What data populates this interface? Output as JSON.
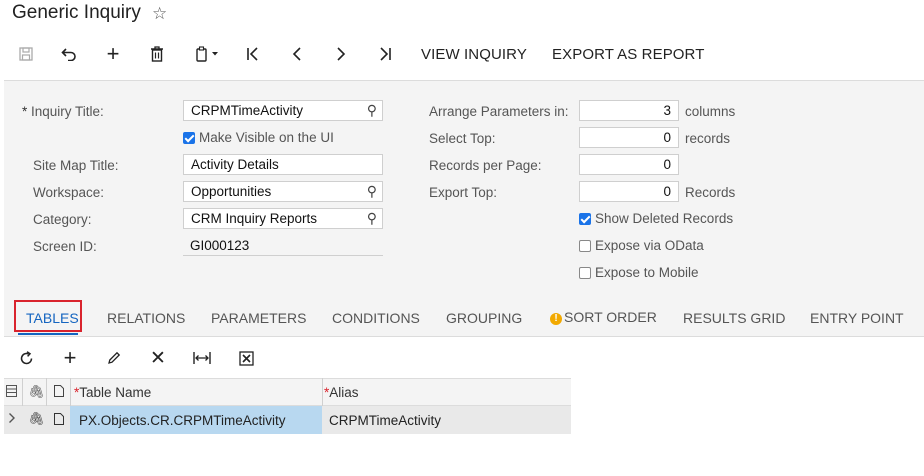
{
  "header": {
    "title": "Generic Inquiry"
  },
  "toolbar": {
    "view_inquiry": "VIEW INQUIRY",
    "export_report": "EXPORT AS REPORT"
  },
  "form": {
    "inquiry_title_label": "Inquiry Title:",
    "inquiry_title_value": "CRPMTimeActivity",
    "make_visible_label": "Make Visible on the UI",
    "make_visible_checked": true,
    "site_map_title_label": "Site Map Title:",
    "site_map_title_value": "Activity Details",
    "workspace_label": "Workspace:",
    "workspace_value": "Opportunities",
    "category_label": "Category:",
    "category_value": "CRM Inquiry Reports",
    "screen_id_label": "Screen ID:",
    "screen_id_value": "GI000123",
    "arrange_label": "Arrange Parameters in:",
    "arrange_value": "3",
    "arrange_unit": "columns",
    "select_top_label": "Select Top:",
    "select_top_value": "0",
    "select_top_unit": "records",
    "records_per_page_label": "Records per Page:",
    "records_per_page_value": "0",
    "export_top_label": "Export Top:",
    "export_top_value": "0",
    "export_top_unit": "Records",
    "show_deleted_label": "Show Deleted Records",
    "show_deleted_checked": true,
    "odata_label": "Expose via OData",
    "odata_checked": false,
    "mobile_label": "Expose to Mobile",
    "mobile_checked": false
  },
  "tabs": [
    "TABLES",
    "RELATIONS",
    "PARAMETERS",
    "CONDITIONS",
    "GROUPING",
    "SORT ORDER",
    "RESULTS GRID",
    "ENTRY POINT"
  ],
  "active_tab": "TABLES",
  "grid": {
    "columns": {
      "table_name": "Table Name",
      "alias": "Alias"
    },
    "rows": [
      {
        "table_name": "PX.Objects.CR.CRPMTimeActivity",
        "alias": "CRPMTimeActivity"
      }
    ]
  },
  "colors": {
    "accent": "#1565c0",
    "highlight_box": "#d9232d",
    "selected_cell": "#b8d8f0",
    "checkbox": "#1a73e8"
  }
}
